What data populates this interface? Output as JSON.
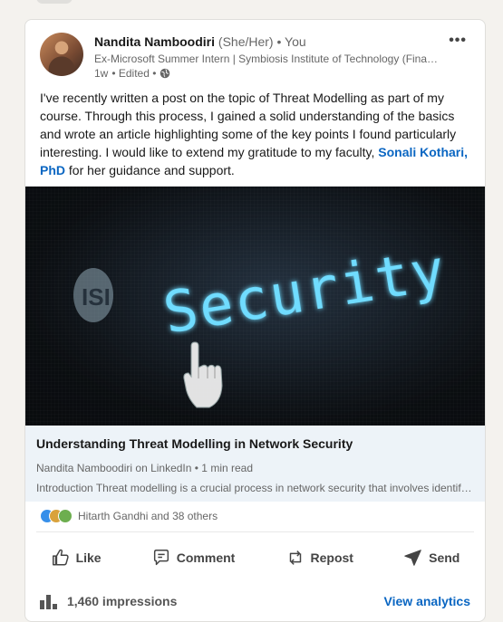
{
  "post": {
    "author_name": "Nandita Namboodiri",
    "pronouns": "(She/Her)",
    "connection": "• You",
    "headline": "Ex-Microsoft Summer Intern | Symbiosis Institute of Technology (Fina…",
    "time": "1w",
    "edited": "• Edited •",
    "text_part1": "I've recently written a post on the topic of Threat Modelling as part of my course. Through this process, I gained a solid understanding of the basics and wrote an article highlighting some of the key points I found particularly interesting. I would like to extend my gratitude to my faculty, ",
    "mention": "Sonali Kothari, PhD",
    "text_part2": " for her guidance and support.",
    "image_word": "Security",
    "image_badge": "ISI"
  },
  "link": {
    "title": "Understanding Threat Modelling in Network Security",
    "source": "Nandita Namboodiri on LinkedIn • 1 min read",
    "description": "Introduction Threat modelling is a crucial process in network security that involves identif…"
  },
  "reactions": {
    "text": "Hitarth Gandhi and 38 others"
  },
  "actions": {
    "like": "Like",
    "comment": "Comment",
    "repost": "Repost",
    "send": "Send"
  },
  "footer": {
    "impressions": "1,460 impressions",
    "view_analytics": "View analytics"
  },
  "icons": {
    "more": "more-icon",
    "globe": "globe-icon",
    "like": "thumbs-up-icon",
    "comment": "comment-icon",
    "repost": "repost-icon",
    "send": "send-icon",
    "analytics": "bar-chart-icon"
  },
  "colors": {
    "link": "#0a66c2",
    "link_bg": "#edf3f8",
    "glow": "#5fd6ff"
  }
}
